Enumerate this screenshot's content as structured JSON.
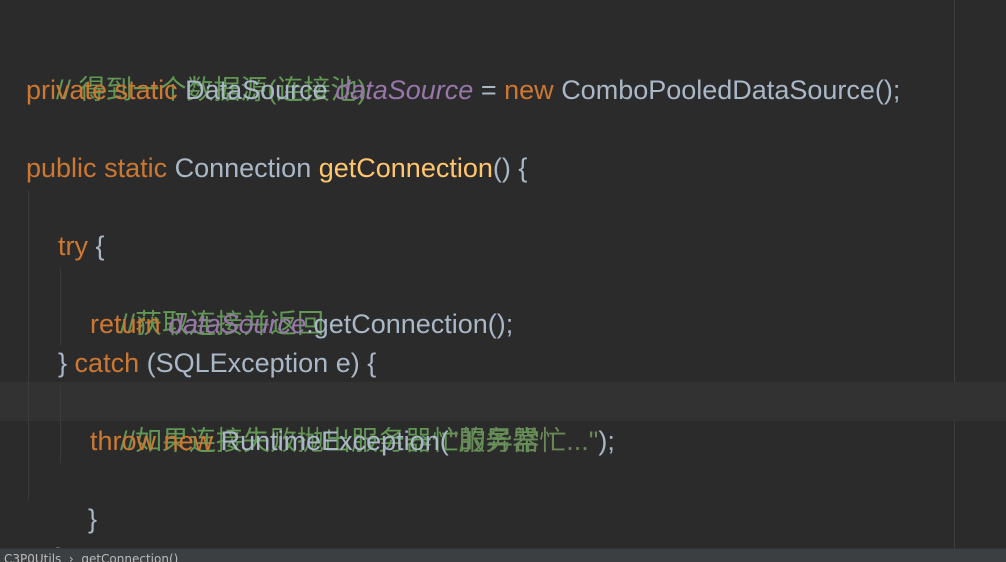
{
  "code": {
    "line1_comment": "// 得到一个数据源(连接池)",
    "line2": {
      "kw_private": "private",
      "kw_static": "static",
      "type": "DataSource",
      "field": "dataSource",
      "equals": "=",
      "kw_new": "new",
      "ctor": "ComboPooledDataSource();"
    },
    "line3": {
      "kw_public": "public",
      "kw_static": "static",
      "type": "Connection",
      "method": "getConnection",
      "rest": "() {"
    },
    "line4": {
      "kw_try": "try",
      "brace": "{"
    },
    "line5_comment": "//获取连接并返回",
    "line6": {
      "kw_return": "return",
      "field": "dataSource",
      "rest": ".getConnection();"
    },
    "line7": {
      "brace_open": "}",
      "kw_catch": "catch",
      "rest": "(SQLException e) {"
    },
    "line8_comment": "//如果连接失败抛出服务器忙的异常",
    "line9": {
      "kw_throw": "throw",
      "kw_new": "new",
      "call": "RuntimeException(",
      "string": "\"服务器忙...\"",
      "rest": ");"
    },
    "line10": "}",
    "line11": "}"
  },
  "status_bar": {
    "breadcrumb": "C3P0Utils  ›  getConnection()"
  }
}
